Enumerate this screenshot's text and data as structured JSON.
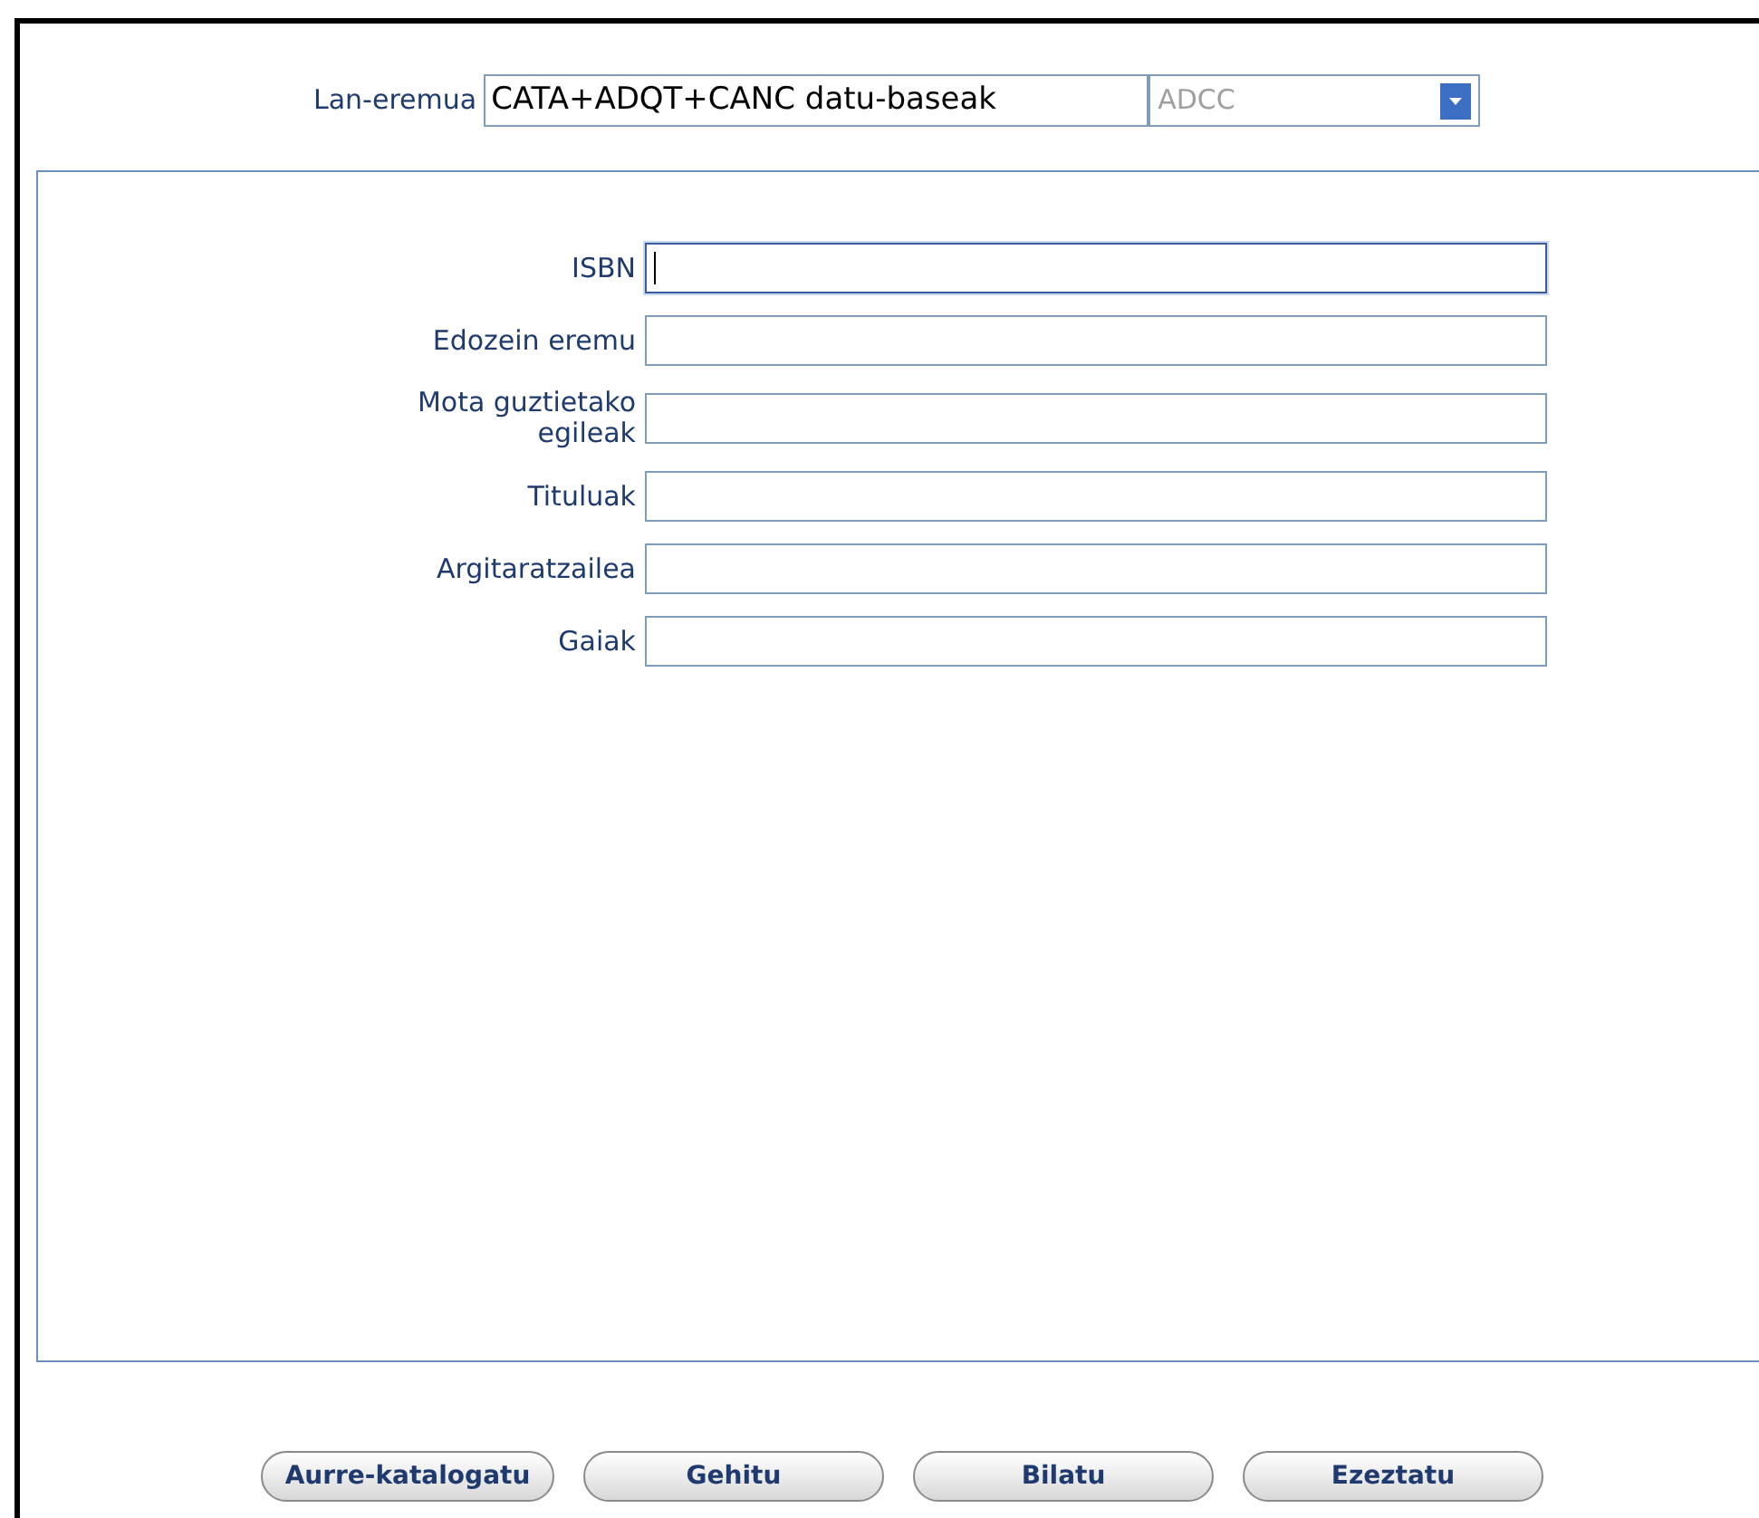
{
  "workspace": {
    "label": "Lan-eremua",
    "value": "CATA+ADQT+CANC datu-baseak",
    "select_value": "ADCC",
    "select_disabled": true
  },
  "fields": [
    {
      "label": "ISBN",
      "focused": true
    },
    {
      "label": "Edozein eremu",
      "focused": false
    },
    {
      "label": "Mota guztietako egileak",
      "focused": false
    },
    {
      "label": "Tituluak",
      "focused": false
    },
    {
      "label": "Argitaratzailea",
      "focused": false
    },
    {
      "label": "Gaiak",
      "focused": false
    }
  ],
  "buttons": [
    "Aurre-katalogatu",
    "Gehitu",
    "Bilatu",
    "Ezeztatu"
  ]
}
